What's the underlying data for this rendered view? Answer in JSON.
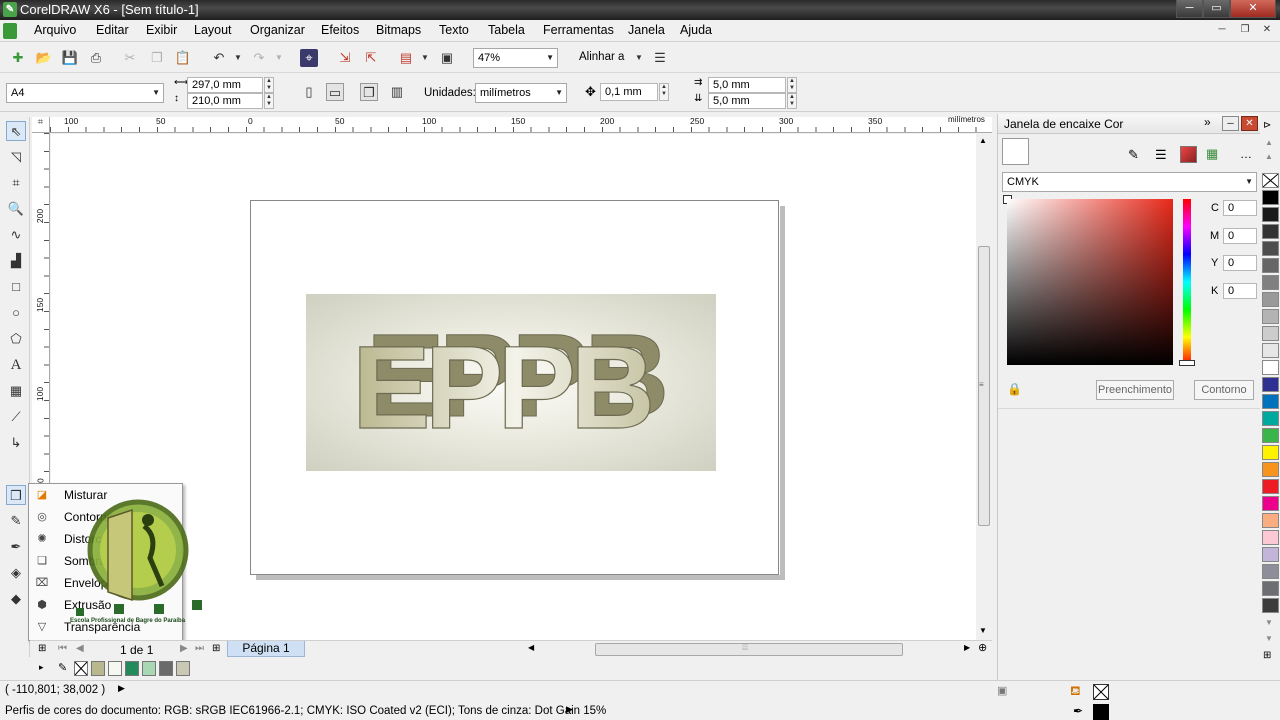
{
  "window": {
    "title": "CorelDRAW X6 - [Sem título-1]",
    "app_icon": "corel-balloon-icon",
    "controls": [
      "minimize-icon",
      "maximize-icon",
      "close-icon"
    ]
  },
  "menubar": {
    "items": [
      "Arquivo",
      "Editar",
      "Exibir",
      "Layout",
      "Organizar",
      "Efeitos",
      "Bitmaps",
      "Texto",
      "Tabela",
      "Ferramentas",
      "Janela",
      "Ajuda"
    ]
  },
  "standard_toolbar": {
    "zoom_value": "47%",
    "align_label": "Alinhar a",
    "icons": [
      "new-icon",
      "open-icon",
      "save-icon",
      "print-icon",
      "cut-icon",
      "copy-icon",
      "paste-icon",
      "undo-icon",
      "redo-icon",
      "import-icon",
      "export-icon",
      "publish-pdf-icon",
      "launcher-icon",
      "fullscreen-icon",
      "options-icon"
    ]
  },
  "property_bar": {
    "page_size": "A4",
    "width": "297,0 mm",
    "height": "210,0 mm",
    "units_label": "Unidades:",
    "units_value": "milímetros",
    "nudge": "0,1 mm",
    "dup_x": "5,0 mm",
    "dup_y": "5,0 mm"
  },
  "rulers": {
    "units": "milímetros",
    "top_ticks": [
      "100",
      "50",
      "0",
      "50",
      "100",
      "150",
      "200",
      "250",
      "300",
      "350"
    ],
    "left_ticks": [
      "200",
      "150",
      "100",
      "50"
    ]
  },
  "canvas": {
    "artwork_text": "EPPB"
  },
  "flyout": {
    "items": [
      {
        "icon": "blend-icon",
        "label": "Misturar"
      },
      {
        "icon": "contour-icon",
        "label": "Contorno"
      },
      {
        "icon": "distort-icon",
        "label": "Distorcer"
      },
      {
        "icon": "shadow-icon",
        "label": "Sombra"
      },
      {
        "icon": "envelope-icon",
        "label": "Envelope"
      },
      {
        "icon": "extrude-icon",
        "label": "Extrusão"
      },
      {
        "icon": "transparency-icon",
        "label": "Transparência"
      }
    ]
  },
  "watermark": {
    "text": "Escola Profissional de Bagre do Paraíba"
  },
  "page_nav": {
    "page_count": "1 de 1",
    "page_tab": "Página 1"
  },
  "document_palette": {
    "colors": [
      "#b9b78e",
      "#f7f7f2",
      "#238a5c",
      "#a9d6b3",
      "#6a6a6a",
      "#c8c8b4"
    ]
  },
  "status": {
    "coords": "( -110,801; 38,002 )",
    "color_profile": "Perfis de cores do documento: RGB: sRGB IEC61966-2.1; CMYK: ISO Coated v2 (ECI); Tons de cinza: Dot Gain 15%"
  },
  "docker": {
    "title": "Janela de encaixe Cor",
    "model": "CMYK",
    "c_label": "C",
    "c_value": "0",
    "m_label": "M",
    "m_value": "0",
    "y_label": "Y",
    "y_value": "0",
    "k_label": "K",
    "k_value": "0",
    "fill_button": "Preenchimento",
    "outline_button": "Contorno"
  },
  "right_palette": {
    "colors": [
      "#000000",
      "#1a1a1a",
      "#333333",
      "#4d4d4d",
      "#666666",
      "#808080",
      "#999999",
      "#b3b3b3",
      "#cccccc",
      "#e6e6e6",
      "#ffffff",
      "#2e3192",
      "#0072bc",
      "#00a99d",
      "#39b54a",
      "#fff200",
      "#f7941d",
      "#ed1c24",
      "#ec008c",
      "#f9ad81",
      "#fbc8d4",
      "#c2b5d9",
      "#8e8e9a",
      "#6d6e71",
      "#3c3c3c"
    ]
  },
  "colors": {
    "accent": "#316ac5",
    "highlight": "#dbe8f7"
  }
}
